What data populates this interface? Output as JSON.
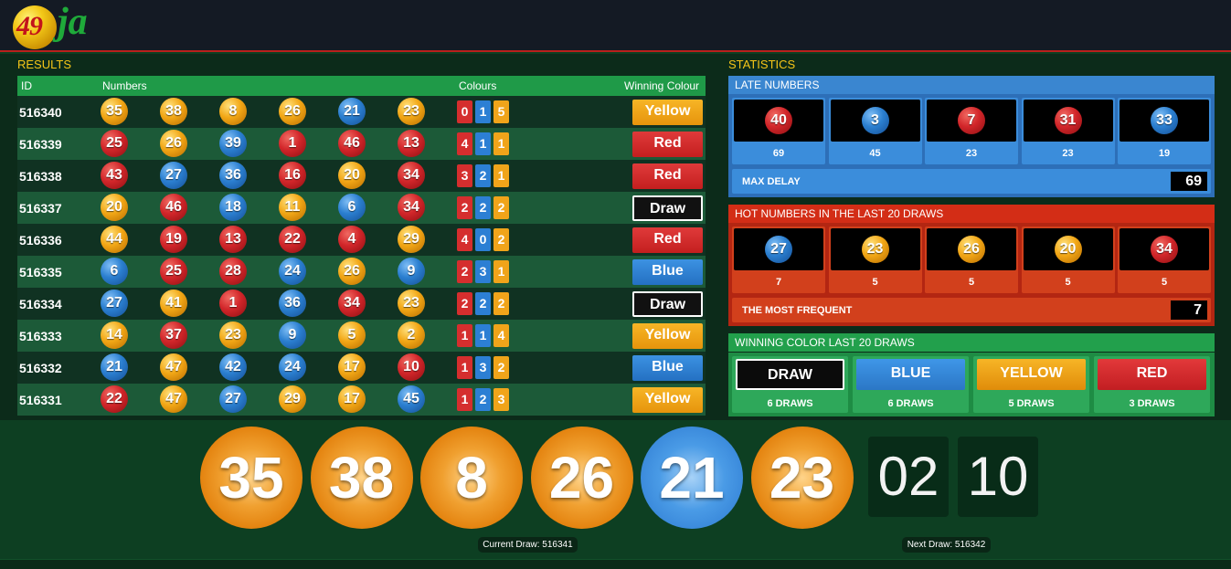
{
  "app": {
    "logo_text": "49ja"
  },
  "results": {
    "title": "RESULTS",
    "headers": {
      "id": "ID",
      "numbers": "Numbers",
      "colours": "Colours",
      "winning": "Winning Colour"
    },
    "rows": [
      {
        "id": "516340",
        "balls": [
          {
            "n": "35",
            "c": "y"
          },
          {
            "n": "38",
            "c": "y"
          },
          {
            "n": "8",
            "c": "y"
          },
          {
            "n": "26",
            "c": "y"
          },
          {
            "n": "21",
            "c": "b"
          },
          {
            "n": "23",
            "c": "y"
          }
        ],
        "counts": [
          "0",
          "1",
          "5"
        ],
        "winner": "Yellow",
        "winner_style": "yellow"
      },
      {
        "id": "516339",
        "balls": [
          {
            "n": "25",
            "c": "r"
          },
          {
            "n": "26",
            "c": "y"
          },
          {
            "n": "39",
            "c": "b"
          },
          {
            "n": "1",
            "c": "r"
          },
          {
            "n": "46",
            "c": "r"
          },
          {
            "n": "13",
            "c": "r"
          }
        ],
        "counts": [
          "4",
          "1",
          "1"
        ],
        "winner": "Red",
        "winner_style": "red"
      },
      {
        "id": "516338",
        "balls": [
          {
            "n": "43",
            "c": "r"
          },
          {
            "n": "27",
            "c": "b"
          },
          {
            "n": "36",
            "c": "b"
          },
          {
            "n": "16",
            "c": "r"
          },
          {
            "n": "20",
            "c": "y"
          },
          {
            "n": "34",
            "c": "r"
          }
        ],
        "counts": [
          "3",
          "2",
          "1"
        ],
        "winner": "Red",
        "winner_style": "red"
      },
      {
        "id": "516337",
        "balls": [
          {
            "n": "20",
            "c": "y"
          },
          {
            "n": "46",
            "c": "r"
          },
          {
            "n": "18",
            "c": "b"
          },
          {
            "n": "11",
            "c": "y"
          },
          {
            "n": "6",
            "c": "b"
          },
          {
            "n": "34",
            "c": "r"
          }
        ],
        "counts": [
          "2",
          "2",
          "2"
        ],
        "winner": "Draw",
        "winner_style": "draw"
      },
      {
        "id": "516336",
        "balls": [
          {
            "n": "44",
            "c": "y"
          },
          {
            "n": "19",
            "c": "r"
          },
          {
            "n": "13",
            "c": "r"
          },
          {
            "n": "22",
            "c": "r"
          },
          {
            "n": "4",
            "c": "r"
          },
          {
            "n": "29",
            "c": "y"
          }
        ],
        "counts": [
          "4",
          "0",
          "2"
        ],
        "winner": "Red",
        "winner_style": "red"
      },
      {
        "id": "516335",
        "balls": [
          {
            "n": "6",
            "c": "b"
          },
          {
            "n": "25",
            "c": "r"
          },
          {
            "n": "28",
            "c": "r"
          },
          {
            "n": "24",
            "c": "b"
          },
          {
            "n": "26",
            "c": "y"
          },
          {
            "n": "9",
            "c": "b"
          }
        ],
        "counts": [
          "2",
          "3",
          "1"
        ],
        "winner": "Blue",
        "winner_style": "blue"
      },
      {
        "id": "516334",
        "balls": [
          {
            "n": "27",
            "c": "b"
          },
          {
            "n": "41",
            "c": "y"
          },
          {
            "n": "1",
            "c": "r"
          },
          {
            "n": "36",
            "c": "b"
          },
          {
            "n": "34",
            "c": "r"
          },
          {
            "n": "23",
            "c": "y"
          }
        ],
        "counts": [
          "2",
          "2",
          "2"
        ],
        "winner": "Draw",
        "winner_style": "draw"
      },
      {
        "id": "516333",
        "balls": [
          {
            "n": "14",
            "c": "y"
          },
          {
            "n": "37",
            "c": "r"
          },
          {
            "n": "23",
            "c": "y"
          },
          {
            "n": "9",
            "c": "b"
          },
          {
            "n": "5",
            "c": "y"
          },
          {
            "n": "2",
            "c": "y"
          }
        ],
        "counts": [
          "1",
          "1",
          "4"
        ],
        "winner": "Yellow",
        "winner_style": "yellow"
      },
      {
        "id": "516332",
        "balls": [
          {
            "n": "21",
            "c": "b"
          },
          {
            "n": "47",
            "c": "y"
          },
          {
            "n": "42",
            "c": "b"
          },
          {
            "n": "24",
            "c": "b"
          },
          {
            "n": "17",
            "c": "y"
          },
          {
            "n": "10",
            "c": "r"
          }
        ],
        "counts": [
          "1",
          "3",
          "2"
        ],
        "winner": "Blue",
        "winner_style": "blue"
      },
      {
        "id": "516331",
        "balls": [
          {
            "n": "22",
            "c": "r"
          },
          {
            "n": "47",
            "c": "y"
          },
          {
            "n": "27",
            "c": "b"
          },
          {
            "n": "29",
            "c": "y"
          },
          {
            "n": "17",
            "c": "y"
          },
          {
            "n": "45",
            "c": "b"
          }
        ],
        "counts": [
          "1",
          "2",
          "3"
        ],
        "winner": "Yellow",
        "winner_style": "yellow"
      }
    ]
  },
  "stats": {
    "title": "STATISTICS",
    "late": {
      "title": "LATE NUMBERS",
      "items": [
        {
          "n": "40",
          "c": "r",
          "v": "69"
        },
        {
          "n": "3",
          "c": "b",
          "v": "45"
        },
        {
          "n": "7",
          "c": "r",
          "v": "23"
        },
        {
          "n": "31",
          "c": "r",
          "v": "23"
        },
        {
          "n": "33",
          "c": "b",
          "v": "19"
        }
      ],
      "bar_label": "MAX DELAY",
      "bar_value": "69"
    },
    "hot": {
      "title": "HOT NUMBERS IN THE LAST 20 DRAWS",
      "items": [
        {
          "n": "27",
          "c": "b",
          "v": "7"
        },
        {
          "n": "23",
          "c": "y",
          "v": "5"
        },
        {
          "n": "26",
          "c": "y",
          "v": "5"
        },
        {
          "n": "20",
          "c": "y",
          "v": "5"
        },
        {
          "n": "34",
          "c": "r",
          "v": "5"
        }
      ],
      "bar_label": "THE MOST FREQUENT",
      "bar_value": "7"
    },
    "winning": {
      "title": "WINNING COLOR LAST 20 DRAWS",
      "items": [
        {
          "label": "DRAW",
          "style": "draw",
          "draws": "6 DRAWS"
        },
        {
          "label": "BLUE",
          "style": "blue",
          "draws": "6 DRAWS"
        },
        {
          "label": "YELLOW",
          "style": "yellow",
          "draws": "5 DRAWS"
        },
        {
          "label": "RED",
          "style": "red",
          "draws": "3 DRAWS"
        }
      ]
    }
  },
  "draw": {
    "balls": [
      {
        "n": "35",
        "c": "y"
      },
      {
        "n": "38",
        "c": "y"
      },
      {
        "n": "8",
        "c": "y"
      },
      {
        "n": "26",
        "c": "y"
      },
      {
        "n": "21",
        "c": "b"
      },
      {
        "n": "23",
        "c": "y"
      }
    ],
    "timer_min": "02",
    "timer_sec": "10",
    "current_label": "Current Draw: 516341",
    "next_label": "Next Draw: 516342"
  },
  "colors": {
    "red": "#d2262a",
    "blue": "#2b7fd0",
    "yellow": "#f2a716",
    "green": "#1f9a48"
  }
}
